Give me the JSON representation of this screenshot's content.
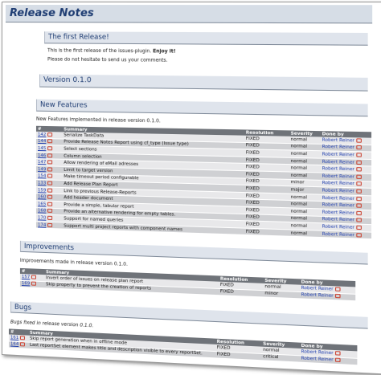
{
  "title": "Release Notes",
  "first_release": {
    "heading": "The first Release!",
    "line1": "This is the first release of the issues-plugin.",
    "line1_bold": "Enjoy it!",
    "line2": "Please do not hesitate to send us your comments."
  },
  "version_heading": "Version 0.1.0",
  "headers": {
    "id": "#",
    "summary": "Summary",
    "resolution": "Resolution",
    "severity": "Severity",
    "done_by": "Done by"
  },
  "new_features": {
    "heading": "New Features",
    "intro": "New Features implemented in release version 0.1.0.",
    "rows": [
      {
        "id": "142",
        "summary": "Serialize TaskData",
        "resolution": "FIXED",
        "severity": "normal",
        "done_by": "Robert Reiner"
      },
      {
        "id": "144",
        "summary": "Provide Release Notes Report using cf_type (Issue type)",
        "resolution": "FIXED",
        "severity": "normal",
        "done_by": "Robert Reiner"
      },
      {
        "id": "145",
        "summary": "Select sections",
        "resolution": "FIXED",
        "severity": "normal",
        "done_by": "Robert Reiner"
      },
      {
        "id": "146",
        "summary": "Column selection",
        "resolution": "FIXED",
        "severity": "normal",
        "done_by": "Robert Reiner"
      },
      {
        "id": "147",
        "summary": "Allow rendering of eMail adresses",
        "resolution": "FIXED",
        "severity": "normal",
        "done_by": "Robert Reiner"
      },
      {
        "id": "149",
        "summary": "Limit to target version",
        "resolution": "FIXED",
        "severity": "normal",
        "done_by": "Robert Reiner"
      },
      {
        "id": "154",
        "summary": "Make timeout period configurable",
        "resolution": "FIXED",
        "severity": "minor",
        "done_by": "Robert Reiner"
      },
      {
        "id": "133",
        "summary": "Add Release Plan Report",
        "resolution": "FIXED",
        "severity": "major",
        "done_by": "Robert Reiner"
      },
      {
        "id": "159",
        "summary": "Link to previous Release-Reports",
        "resolution": "FIXED",
        "severity": "normal",
        "done_by": "Robert Reiner"
      },
      {
        "id": "160",
        "summary": "Add header document",
        "resolution": "FIXED",
        "severity": "normal",
        "done_by": "Robert Reiner"
      },
      {
        "id": "165",
        "summary": "Provide a simple, tabular report",
        "resolution": "FIXED",
        "severity": "normal",
        "done_by": "Robert Reiner"
      },
      {
        "id": "168",
        "summary": "Provide an alternative rendering for empty tables.",
        "resolution": "FIXED",
        "severity": "normal",
        "done_by": "Robert Reiner"
      },
      {
        "id": "170",
        "summary": "Support for named queries",
        "resolution": "FIXED",
        "severity": "normal",
        "done_by": "Robert Reiner"
      },
      {
        "id": "174",
        "summary": "Support multi project reports with component names",
        "resolution": "FIXED",
        "severity": "normal",
        "done_by": "Robert Reiner"
      }
    ]
  },
  "improvements": {
    "heading": "Improvements",
    "intro": "Improvements made in release version 0.1.0.",
    "rows": [
      {
        "id": "157",
        "summary": "Invert order of issues on release plan report",
        "resolution": "FIXED",
        "severity": "normal",
        "done_by": "Robert Reiner"
      },
      {
        "id": "169",
        "summary": "Skip property to prevent the creation of reports",
        "resolution": "FIXED",
        "severity": "minor",
        "done_by": "Robert Reiner"
      }
    ]
  },
  "bugs": {
    "heading": "Bugs",
    "intro": "Bugs fixed in release version 0.1.0.",
    "rows": [
      {
        "id": "161",
        "summary": "Skip report generation when in offline mode",
        "resolution": "FIXED",
        "severity": "normal",
        "done_by": "Robert Reiner"
      },
      {
        "id": "164",
        "summary": "Last reportSet element makes title and description visible to every reportSet.",
        "resolution": "FIXED",
        "severity": "critical",
        "done_by": "Robert Reiner"
      }
    ]
  },
  "colors": {
    "heading_text": "#1f3d73",
    "section_bg": "#dfe4ec",
    "table_header_bg": "#6f7379",
    "link": "#2140b0"
  }
}
